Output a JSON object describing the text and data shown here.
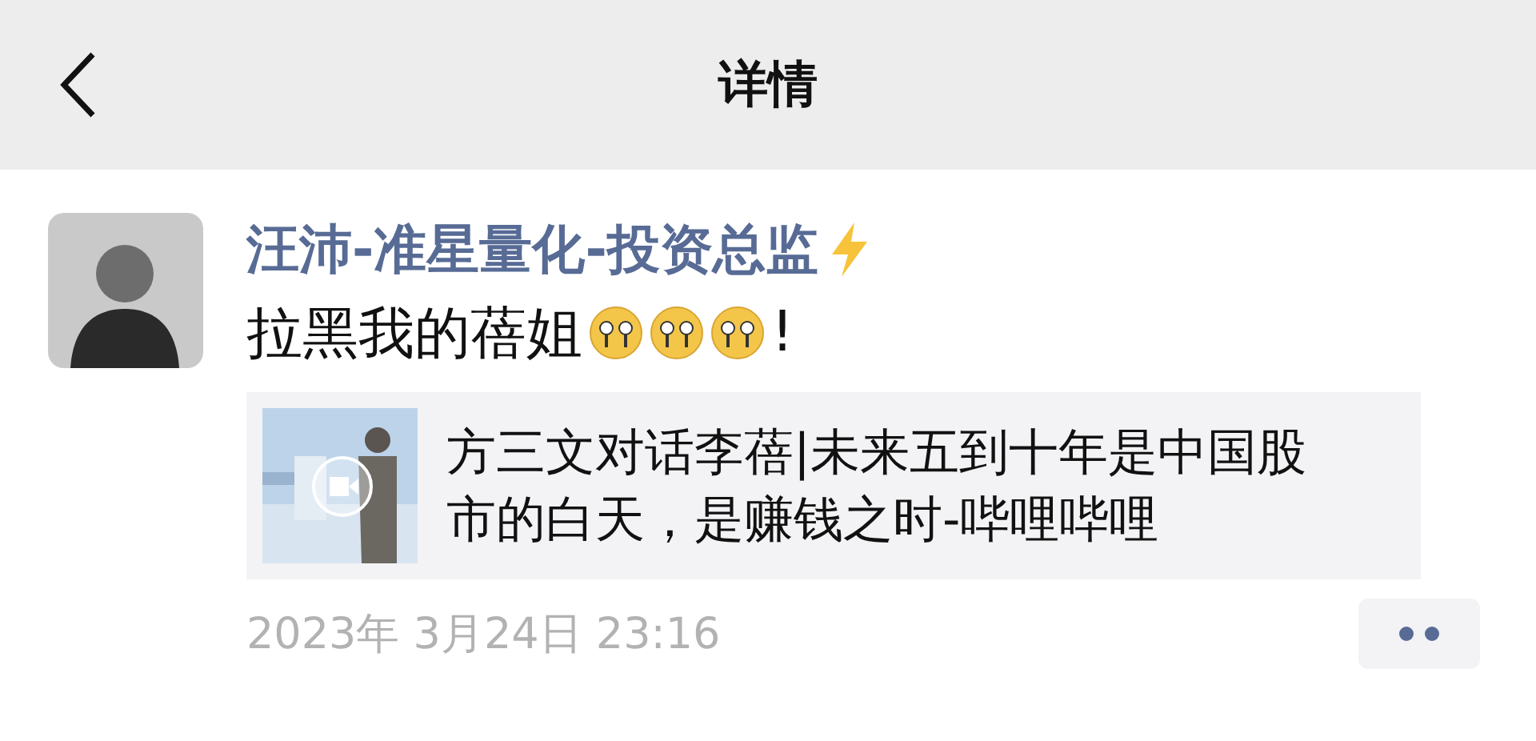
{
  "nav": {
    "title": "详情"
  },
  "post": {
    "author": "汪沛-准星量化-投资总监",
    "text": "拉黑我的蓓姐",
    "emojis": [
      {
        "kind": "face"
      },
      {
        "kind": "face"
      },
      {
        "kind": "face"
      }
    ],
    "text_end": "!",
    "link": {
      "title": "方三文对话李蓓|未来五到十年是中国股市的白天，是赚钱之时-哔哩哔哩"
    },
    "time": "2023年 3月24日 23:16"
  }
}
